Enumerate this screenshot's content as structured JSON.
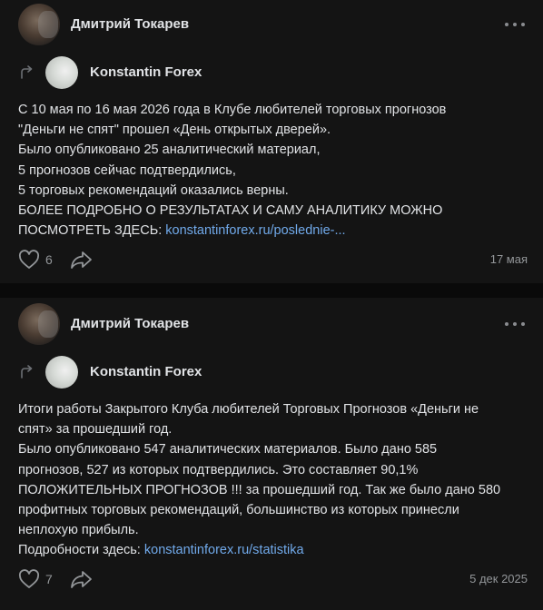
{
  "posts": [
    {
      "author": "Дмитрий Токарев",
      "repost_author": "Konstantin Forex",
      "lines": [
        "С 10 мая по 16 мая 2026 года в Клубе любителей торговых прогнозов",
        "\"Деньги не спят\" прошел «День открытых дверей».",
        "Было опубликовано 25 аналитический материал,",
        "5 прогнозов сейчас подтвердились,",
        "5 торговых рекомендаций оказались верны.",
        "БОЛЕЕ ПОДРОБНО О РЕЗУЛЬТАТАХ И САМУ АНАЛИТИКУ МОЖНО"
      ],
      "last_line_text": "ПОСМОТРЕТЬ ЗДЕСЬ: ",
      "link": "konstantinforex.ru/poslednie-...",
      "likes": "6",
      "date": "17 мая"
    },
    {
      "author": "Дмитрий Токарев",
      "repost_author": "Konstantin Forex",
      "lines": [
        "Итоги работы Закрытого Клуба любителей Торговых Прогнозов «Деньги не",
        "спят» за прошедший год.",
        "Было опубликовано 547 аналитических материалов. Было дано 585",
        "прогнозов, 527 из которых подтвердились. Это составляет 90,1%",
        "ПОЛОЖИТЕЛЬНЫХ ПРОГНОЗОВ !!! за прошедший год. Так же было дано 580",
        "профитных торговых рекомендаций, большинство из которых принесли",
        "неплохую прибыль."
      ],
      "last_line_text": "Подробности здесь: ",
      "link": "konstantinforex.ru/statistika",
      "likes": "7",
      "date": "5 дек 2025"
    }
  ],
  "icons": {
    "more": "more-horizontal-icon",
    "repost": "repost-arrow-icon",
    "like": "heart-outline-icon",
    "share": "share-arrow-icon"
  },
  "colors": {
    "background": "#141414",
    "text": "#e1e3e6",
    "link": "#71aaeb",
    "muted": "#939699"
  }
}
